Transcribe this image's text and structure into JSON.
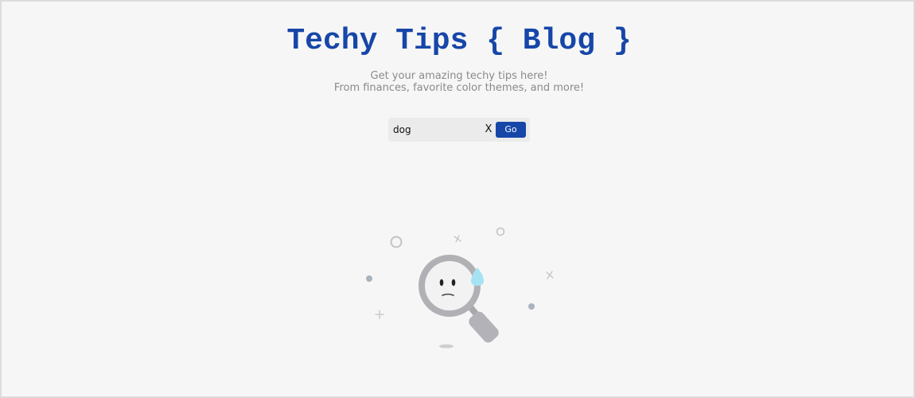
{
  "header": {
    "title": "Techy Tips { Blog }",
    "subtitle_line1": "Get your amazing techy tips here!",
    "subtitle_line2": "From finances, favorite color themes, and more!"
  },
  "search": {
    "value": "dog",
    "clear_label": "X",
    "go_label": "Go"
  },
  "empty_state": {
    "icon": "no-results-magnifier-illustration"
  },
  "colors": {
    "brand": "#1646a8",
    "background": "#f6f6f6",
    "subtitle": "#8a8a8a"
  }
}
